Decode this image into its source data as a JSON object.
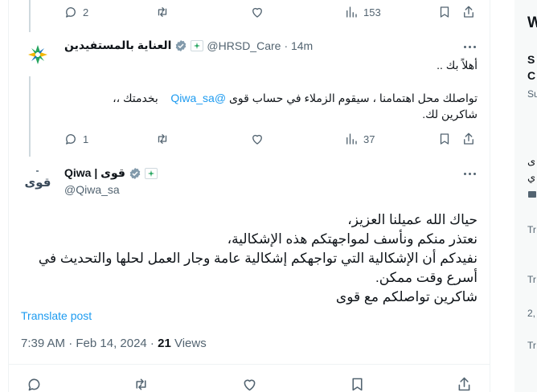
{
  "top_actions": {
    "replies": "2",
    "views": "153"
  },
  "reply": {
    "display_name": "العناية بالمستفيدين",
    "handle": "@HRSD_Care",
    "time": "· 14m",
    "line1": "أهلاً بك ..",
    "line2_main": "تواصلك محل اهتمامنا ، سيقوم الزملاء في حساب قوى",
    "line2_mention": "@Qiwa_sa",
    "line2_tail": "بخدمتك ،،",
    "line3": "شاكرين لك.",
    "replies": "1",
    "views": "37"
  },
  "main_post": {
    "display_name": "Qiwa | قوى",
    "handle": "@Qiwa_sa",
    "body": [
      "حياك الله عميلنا العزيز،",
      "نعتذر منكم ونأسف لمواجهتكم هذه الإشكالية،",
      "نفيدكم أن الإشكالية التي تواجهكم إشكالية عامة وجار العمل لحلها والتحديث في أسرع وقت ممكن.",
      "شاكرين تواصلكم مع قوى"
    ],
    "translate_label": "Translate post",
    "timestamp": "7:39 AM · Feb 14, 2024 · ",
    "views_count": "21",
    "views_label": " Views"
  },
  "sidebar": {
    "glimpse": [
      "W",
      "S",
      "C",
      "Su",
      "ى",
      "ي",
      "Tr",
      "Tr",
      "2,",
      "Tr"
    ]
  },
  "colors": {
    "accent": "#1d9bf0",
    "secondary_text": "#536471",
    "verified": "#829aab"
  }
}
